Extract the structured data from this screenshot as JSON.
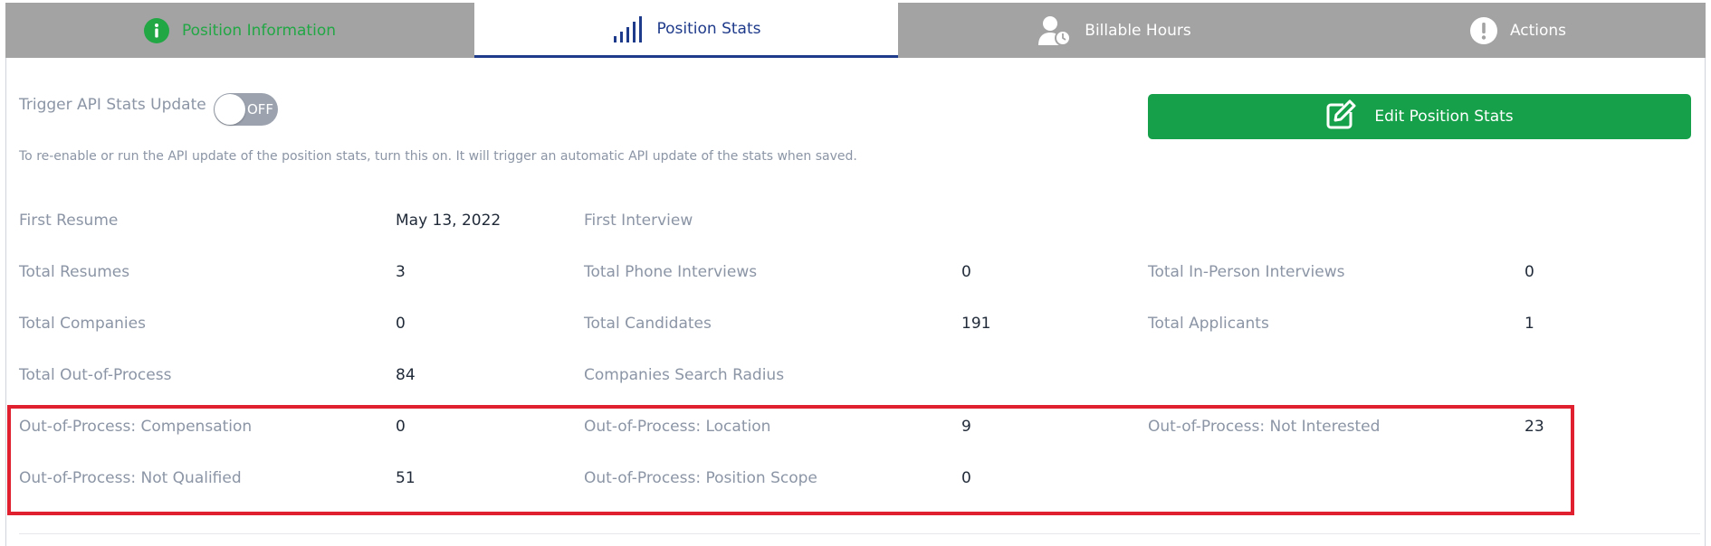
{
  "tabs": [
    {
      "label": "Position Information",
      "icon": "info-circle-icon"
    },
    {
      "label": "Position Stats",
      "icon": "signal-bars-icon"
    },
    {
      "label": "Billable Hours",
      "icon": "user-clock-icon"
    },
    {
      "label": "Actions",
      "icon": "exclamation-circle-icon"
    }
  ],
  "active_tab": "Position Stats",
  "toggle": {
    "label": "Trigger API Stats Update",
    "state": "OFF"
  },
  "help_text": "To re-enable or run the API update of the position stats, turn this on. It will trigger an automatic API update of the stats when saved.",
  "edit_button": {
    "label": "Edit Position Stats",
    "icon": "edit-square-icon"
  },
  "colors": {
    "tabbar_bg": "#a3a3a3",
    "active_tab_text": "#1e3a8a",
    "info_tab_text": "#22a745",
    "primary_button": "#15a049",
    "highlight_border": "#e0202e",
    "label_text": "#8b95a5"
  },
  "stats": {
    "first_resume": {
      "label": "First Resume",
      "value": "May 13, 2022"
    },
    "first_interview": {
      "label": "First Interview",
      "value": ""
    },
    "total_resumes": {
      "label": "Total Resumes",
      "value": "3"
    },
    "total_phone_interviews": {
      "label": "Total Phone Interviews",
      "value": "0"
    },
    "total_in_person_interviews": {
      "label": "Total In-Person Interviews",
      "value": "0"
    },
    "total_companies": {
      "label": "Total Companies",
      "value": "0"
    },
    "total_candidates": {
      "label": "Total Candidates",
      "value": "191"
    },
    "total_applicants": {
      "label": "Total Applicants",
      "value": "1"
    },
    "total_out_of_process": {
      "label": "Total Out-of-Process",
      "value": "84"
    },
    "companies_search_radius": {
      "label": "Companies Search Radius",
      "value": ""
    },
    "oop_compensation": {
      "label": "Out-of-Process: Compensation",
      "value": "0"
    },
    "oop_location": {
      "label": "Out-of-Process: Location",
      "value": "9"
    },
    "oop_not_interested": {
      "label": "Out-of-Process: Not Interested",
      "value": "23"
    },
    "oop_not_qualified": {
      "label": "Out-of-Process: Not Qualified",
      "value": "51"
    },
    "oop_position_scope": {
      "label": "Out-of-Process: Position Scope",
      "value": "0"
    }
  }
}
